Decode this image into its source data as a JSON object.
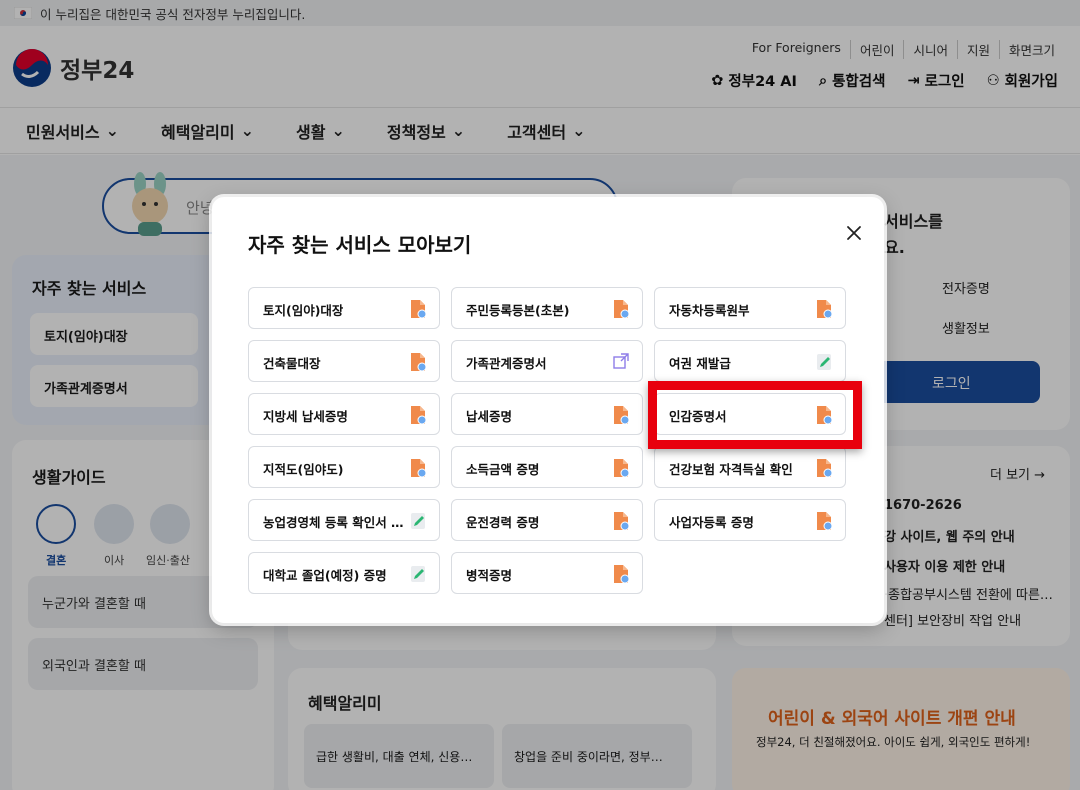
{
  "gov_banner": {
    "text": "이 누리집은 대한민국 공식 전자정부 누리집입니다."
  },
  "header": {
    "logo_text": "정부24",
    "utils": [
      "For Foreigners",
      "어린이",
      "시니어",
      "지원",
      "화면크기"
    ],
    "actions": [
      "정부24 AI",
      "통합검색",
      "로그인",
      "회원가입"
    ]
  },
  "gnb": [
    "민원서비스",
    "혜택알리미",
    "생활",
    "정책정보",
    "고객센터"
  ],
  "search": {
    "placeholder": "안녕"
  },
  "left_fav": {
    "title": "자주 찾는 서비스",
    "items": [
      "토지(임야)대장",
      "가족관계증명서"
    ]
  },
  "guide": {
    "title": "생활가이드",
    "icons": [
      "결혼",
      "이사",
      "임신·출산"
    ],
    "rows": [
      "누군가와 결혼할 때",
      "외국인과 결혼할 때"
    ]
  },
  "right": {
    "login_text_1": "서비스를",
    "login_text_2": "요.",
    "links": [
      "전자증명",
      "생활정보"
    ],
    "login_button": "로그인",
    "more": "더 보기 →",
    "notices": [
      "1670-2626",
      "강 사이트, 웹 주의 안내",
      "사용자 이용 제한 안내",
      "·종합공부시스템 전환에 따른…",
      "센터] 보안장비 작업 안내"
    ],
    "banner_title": "어린이 & 외국어 사이트 개편 안내",
    "banner_sub": "정부24, 더 친절해졌어요. 아이도 쉽게, 외국인도 편하게!"
  },
  "benefit": {
    "title": "혜택알리미",
    "items": [
      "급한 생활비, 대출 연체, 신용…",
      "창업을 준비 중이라면, 정부…"
    ]
  },
  "modal": {
    "title": "자주 찾는 서비스 모아보기",
    "close_label": "닫기",
    "services": [
      {
        "label": "토지(임야)대장",
        "icon": "document-icon"
      },
      {
        "label": "주민등록등본(초본)",
        "icon": "document-icon"
      },
      {
        "label": "자동차등록원부",
        "icon": "document-icon"
      },
      {
        "label": "건축물대장",
        "icon": "document-icon"
      },
      {
        "label": "가족관계증명서",
        "icon": "external-link-icon"
      },
      {
        "label": "여권 재발급",
        "icon": "edit-icon"
      },
      {
        "label": "지방세 납세증명",
        "icon": "document-icon"
      },
      {
        "label": "납세증명",
        "icon": "document-icon"
      },
      {
        "label": "인감증명서",
        "icon": "document-icon"
      },
      {
        "label": "지적도(임야도)",
        "icon": "document-icon"
      },
      {
        "label": "소득금액 증명",
        "icon": "document-icon"
      },
      {
        "label": "건강보험 자격득실 확인",
        "icon": "document-icon"
      },
      {
        "label": "농업경영체 등록 확인서 …",
        "icon": "edit-icon"
      },
      {
        "label": "운전경력 증명",
        "icon": "document-icon"
      },
      {
        "label": "사업자등록 증명",
        "icon": "document-icon"
      },
      {
        "label": "대학교 졸업(예정) 증명",
        "icon": "edit-icon"
      },
      {
        "label": "병적증명",
        "icon": "document-icon"
      }
    ]
  },
  "colors": {
    "brand_blue": "#1b4ea0",
    "highlight_red": "#e8000d",
    "doc_orange": "#f08a4b"
  }
}
